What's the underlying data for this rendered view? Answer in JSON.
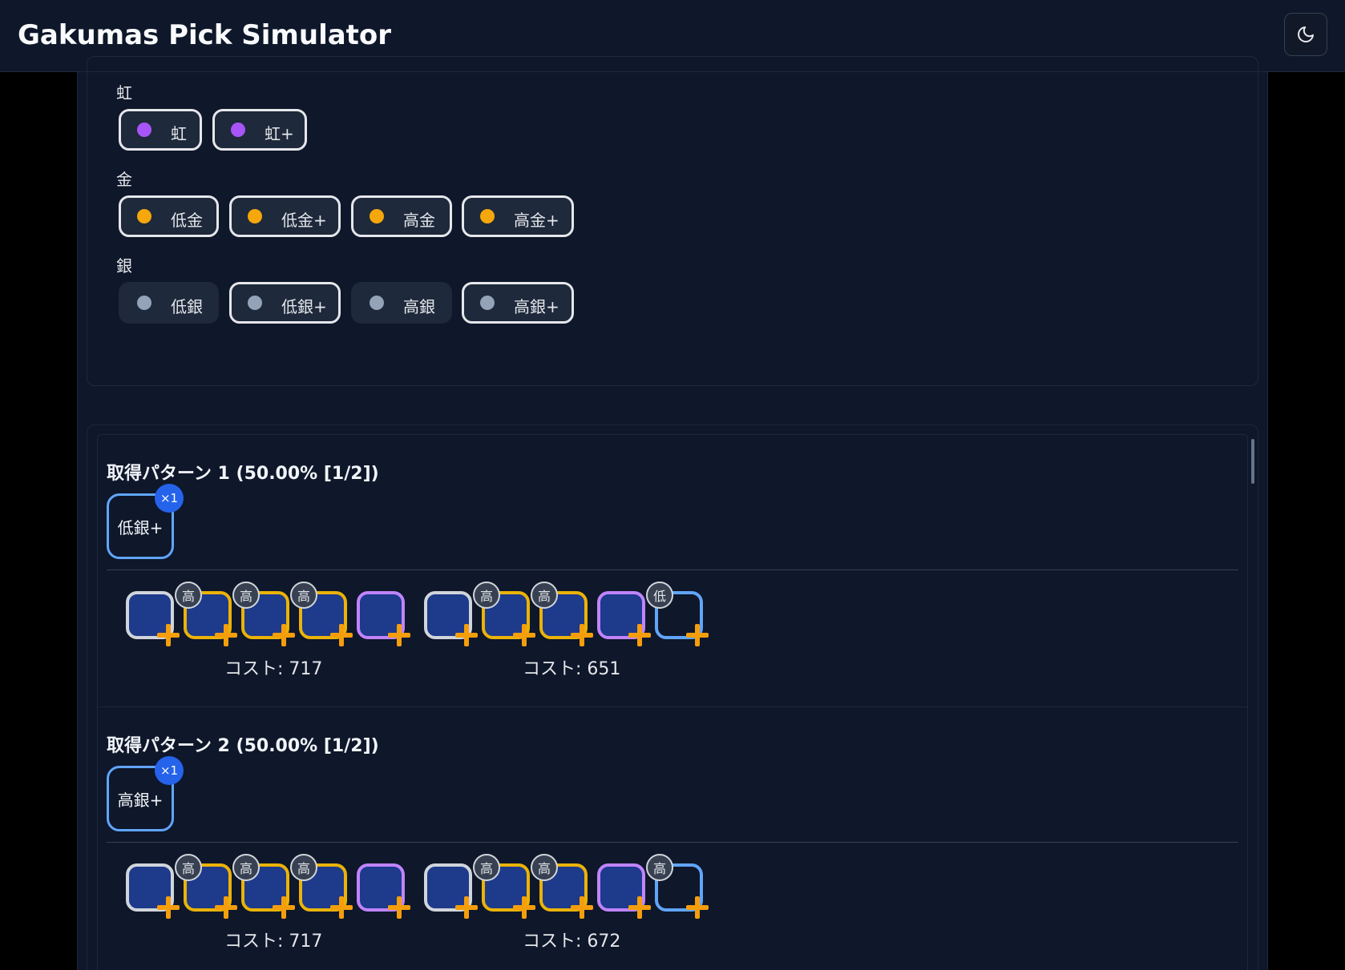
{
  "app": {
    "title": "Gakumas Pick Simulator",
    "theme_icon": "moon-icon"
  },
  "filters": {
    "groups": [
      {
        "label": "虹",
        "color": "#a855f7",
        "chips": [
          {
            "label": "虹",
            "selected": true
          },
          {
            "label": "虹+",
            "selected": true
          }
        ]
      },
      {
        "label": "金",
        "color": "#f5a70b",
        "chips": [
          {
            "label": "低金",
            "selected": true
          },
          {
            "label": "低金+",
            "selected": true
          },
          {
            "label": "高金",
            "selected": true
          },
          {
            "label": "高金+",
            "selected": true
          }
        ]
      },
      {
        "label": "銀",
        "color": "#94a3b8",
        "chips": [
          {
            "label": "低銀",
            "selected": false
          },
          {
            "label": "低銀+",
            "selected": true
          },
          {
            "label": "高銀",
            "selected": false
          },
          {
            "label": "高銀+",
            "selected": true
          }
        ]
      }
    ]
  },
  "patterns": [
    {
      "title": "取得パターン 1 (50.00% [1/2])",
      "picked": {
        "label": "低銀+",
        "count": "×1"
      },
      "decks": [
        {
          "cost": "コスト: 717",
          "slots": [
            {
              "frame": "silver",
              "tier": ""
            },
            {
              "frame": "gold",
              "tier": "高"
            },
            {
              "frame": "gold",
              "tier": "高"
            },
            {
              "frame": "gold",
              "tier": "高"
            },
            {
              "frame": "purple",
              "tier": ""
            }
          ]
        },
        {
          "cost": "コスト: 651",
          "slots": [
            {
              "frame": "silver",
              "tier": ""
            },
            {
              "frame": "gold",
              "tier": "高"
            },
            {
              "frame": "gold",
              "tier": "高"
            },
            {
              "frame": "purple",
              "tier": ""
            },
            {
              "frame": "blue",
              "tier": "低"
            }
          ]
        }
      ]
    },
    {
      "title": "取得パターン 2 (50.00% [1/2])",
      "picked": {
        "label": "高銀+",
        "count": "×1"
      },
      "decks": [
        {
          "cost": "コスト: 717",
          "slots": [
            {
              "frame": "silver",
              "tier": ""
            },
            {
              "frame": "gold",
              "tier": "高"
            },
            {
              "frame": "gold",
              "tier": "高"
            },
            {
              "frame": "gold",
              "tier": "高"
            },
            {
              "frame": "purple",
              "tier": ""
            }
          ]
        },
        {
          "cost": "コスト: 672",
          "slots": [
            {
              "frame": "silver",
              "tier": ""
            },
            {
              "frame": "gold",
              "tier": "高"
            },
            {
              "frame": "gold",
              "tier": "高"
            },
            {
              "frame": "purple",
              "tier": ""
            },
            {
              "frame": "blue",
              "tier": "高"
            }
          ]
        }
      ]
    }
  ]
}
